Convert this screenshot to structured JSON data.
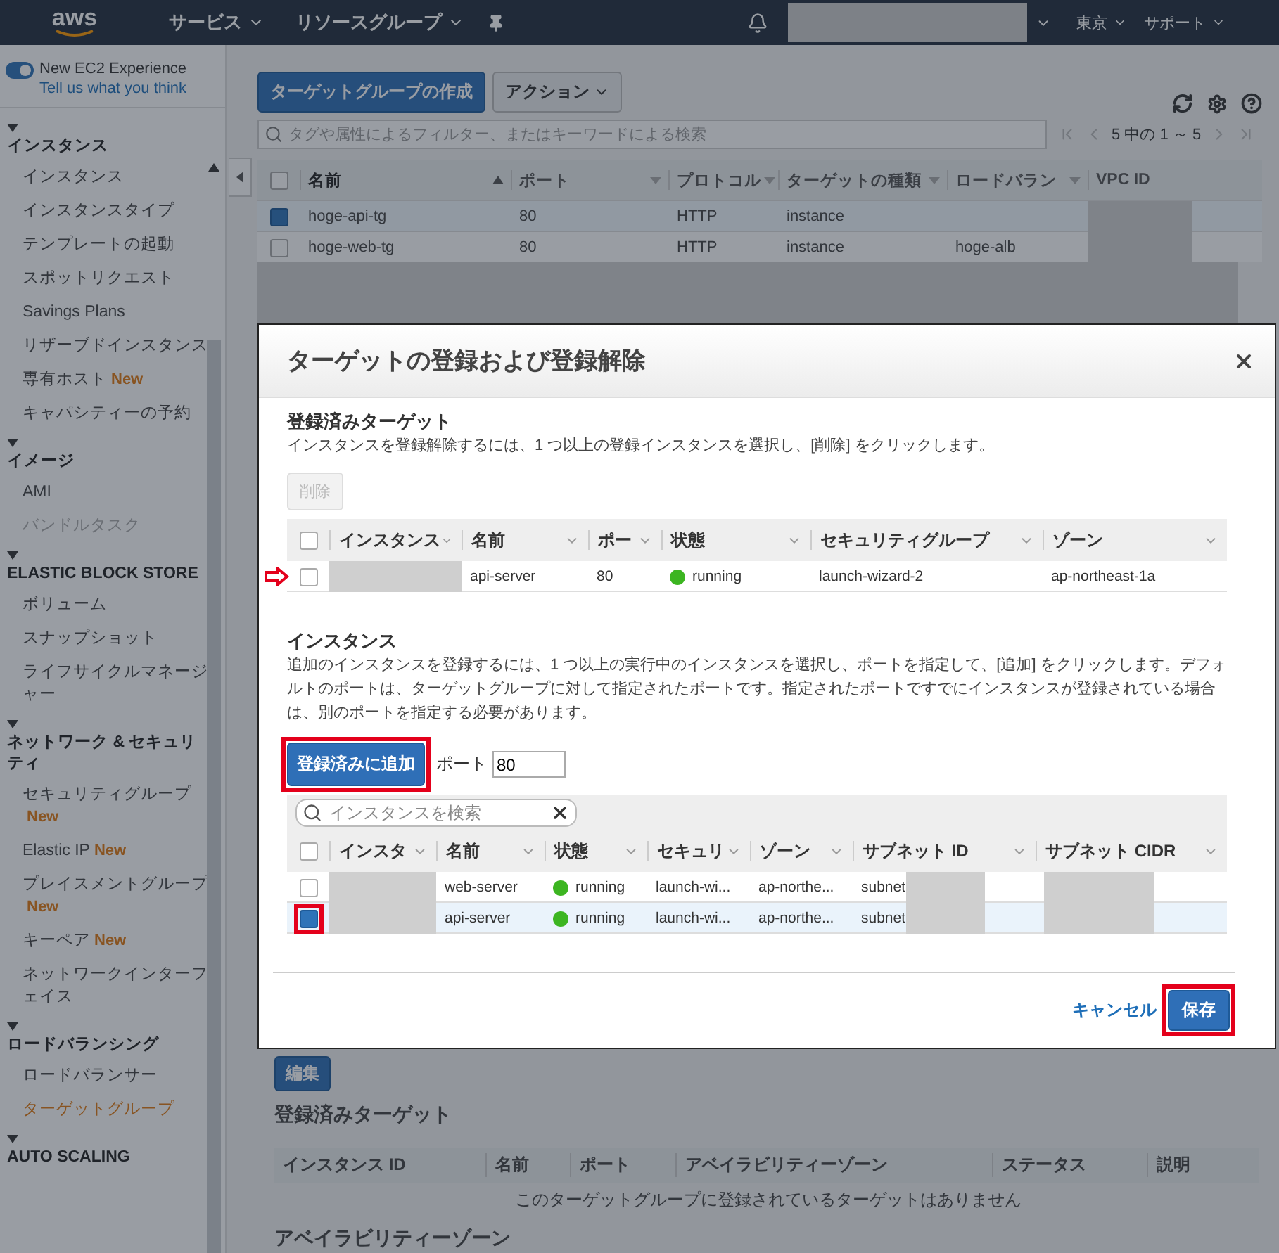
{
  "topbar": {
    "logo": "aws",
    "menus": [
      {
        "label": "サービス"
      },
      {
        "label": "リソースグループ"
      }
    ],
    "region": "東京",
    "support": "サポート"
  },
  "sidebar": {
    "experience": {
      "label": "New EC2 Experience",
      "link": "Tell us what you think",
      "on": true
    },
    "sections": [
      {
        "title": "インスタンス",
        "items": [
          {
            "label": "インスタンス",
            "selected": false,
            "disabled": false
          },
          {
            "label": "インスタンスタイプ",
            "selected": false,
            "disabled": false
          },
          {
            "label": "テンプレートの起動",
            "selected": false,
            "disabled": false
          },
          {
            "label": "スポットリクエスト",
            "selected": false,
            "disabled": false
          },
          {
            "label": "Savings Plans",
            "selected": false,
            "disabled": false
          },
          {
            "label": "リザーブドインスタンス",
            "selected": false,
            "disabled": false
          },
          {
            "label": "専有ホスト",
            "badge": "New",
            "selected": false,
            "disabled": false
          },
          {
            "label": "キャパシティーの予約",
            "selected": false,
            "disabled": false
          }
        ]
      },
      {
        "title": "イメージ",
        "items": [
          {
            "label": "AMI",
            "selected": false,
            "disabled": false
          },
          {
            "label": "バンドルタスク",
            "selected": false,
            "disabled": true
          }
        ]
      },
      {
        "title": "ELASTIC BLOCK STORE",
        "items": [
          {
            "label": "ボリューム",
            "selected": false,
            "disabled": false
          },
          {
            "label": "スナップショット",
            "selected": false,
            "disabled": false
          },
          {
            "label": "ライフサイクルマネージャー",
            "selected": false,
            "disabled": false
          }
        ]
      },
      {
        "title": "ネットワーク & セキュリティ",
        "items": [
          {
            "label": "セキュリティグループ",
            "badge": "New",
            "selected": false,
            "disabled": false
          },
          {
            "label": "Elastic IP",
            "badge": "New",
            "selected": false,
            "disabled": false
          },
          {
            "label": "プレイスメントグループ",
            "badge": "New",
            "selected": false,
            "disabled": false
          },
          {
            "label": "キーペア",
            "badge": "New",
            "selected": false,
            "disabled": false
          },
          {
            "label": "ネットワークインターフェイス",
            "selected": false,
            "disabled": false
          }
        ]
      },
      {
        "title": "ロードバランシング",
        "items": [
          {
            "label": "ロードバランサー",
            "selected": false,
            "disabled": false
          },
          {
            "label": "ターゲットグループ",
            "selected": true,
            "disabled": false
          }
        ]
      },
      {
        "title": "AUTO SCALING"
      }
    ]
  },
  "main": {
    "create_button": "ターゲットグループの作成",
    "actions_button": "アクション",
    "filter": {
      "placeholder": "タグや属性によるフィルター、またはキーワードによる検索"
    },
    "pager": "5 中の 1 ～ 5",
    "table": {
      "all_selected": false,
      "columns": [
        {
          "label": "名前",
          "sortable": true,
          "sorted": true
        },
        {
          "label": "ポート",
          "sortable": true,
          "sorted": false
        },
        {
          "label": "プロトコル",
          "sortable": true,
          "sorted": false
        },
        {
          "label": "ターゲットの種類",
          "sortable": true,
          "sorted": false
        },
        {
          "label": "ロードバラン",
          "sortable": true,
          "sorted": false
        },
        {
          "label": "VPC ID",
          "sortable": false,
          "sorted": false
        }
      ],
      "rows": [
        {
          "selected": true,
          "cells": [
            "hoge-api-tg",
            "80",
            "HTTP",
            "instance",
            ""
          ]
        },
        {
          "selected": false,
          "cells": [
            "hoge-web-tg",
            "80",
            "HTTP",
            "instance",
            "hoge-alb"
          ]
        }
      ]
    },
    "edit_button": "編集",
    "registered_heading": "登録済みターゲット",
    "registered_columns": [
      "インスタンス ID",
      "名前",
      "ポート",
      "アベイラビリティーゾーン",
      "ステータス",
      "説明"
    ],
    "empty_message": "このターゲットグループに登録されているターゲットはありません",
    "next_heading": "アベイラビリティーゾーン"
  },
  "dialog": {
    "title": "ターゲットの登録および登録解除",
    "registered": {
      "heading": "登録済みターゲット",
      "description": "インスタンスを登録解除するには、1 つ以上の登録インスタンスを選択し、[削除] をクリックします。",
      "remove_button": {
        "label": "削除",
        "disabled": true
      },
      "all_selected": false,
      "columns": [
        "インスタンス",
        "名前",
        "ポー",
        "状態",
        "セキュリティグループ",
        "ゾーン"
      ],
      "rows": [
        {
          "selected": false,
          "marked": true,
          "cells": [
            {
              "kind": "redacted"
            },
            {
              "kind": "text",
              "text": "api-server"
            },
            {
              "kind": "text",
              "text": "80"
            },
            {
              "kind": "status",
              "text": "running",
              "color": "#3cb521"
            },
            {
              "kind": "text",
              "text": "launch-wizard-2"
            },
            {
              "kind": "text",
              "text": "ap-northeast-1a"
            }
          ]
        }
      ]
    },
    "instances": {
      "heading": "インスタンス",
      "description": "追加のインスタンスを登録するには、1 つ以上の実行中のインスタンスを選択し、ポートを指定して、[追加] をクリックします。デフォルトのポートは、ターゲットグループに対して指定されたポートです。指定されたポートですでにインスタンスが登録されている場合は、別のポートを指定する必要があります。",
      "add_button": {
        "label": "登録済みに追加",
        "highlighted": true
      },
      "port_label": "ポート",
      "port_value": "80",
      "search": {
        "placeholder": "インスタンスを検索"
      },
      "all_selected": false,
      "columns": [
        "インスタ",
        "名前",
        "状態",
        "セキュリ",
        "ゾーン",
        "サブネット ID",
        "サブネット CIDR"
      ],
      "rows": [
        {
          "selected": false,
          "highlighted": false,
          "cells": [
            {
              "kind": "redacted"
            },
            {
              "kind": "text",
              "text": "web-server"
            },
            {
              "kind": "status",
              "text": "running",
              "color": "#3cb521"
            },
            {
              "kind": "text",
              "text": "launch-wi..."
            },
            {
              "kind": "text",
              "text": "ap-northe..."
            },
            {
              "kind": "partial",
              "text": "subnet"
            },
            {
              "kind": "redacted"
            }
          ]
        },
        {
          "selected": true,
          "highlighted": true,
          "cells": [
            {
              "kind": "redacted"
            },
            {
              "kind": "text",
              "text": "api-server"
            },
            {
              "kind": "status",
              "text": "running",
              "color": "#3cb521"
            },
            {
              "kind": "text",
              "text": "launch-wi..."
            },
            {
              "kind": "text",
              "text": "ap-northe..."
            },
            {
              "kind": "partial",
              "text": "subnet"
            },
            {
              "kind": "redacted"
            }
          ]
        }
      ]
    },
    "cancel": "キャンセル",
    "save": {
      "label": "保存",
      "highlighted": true
    }
  }
}
